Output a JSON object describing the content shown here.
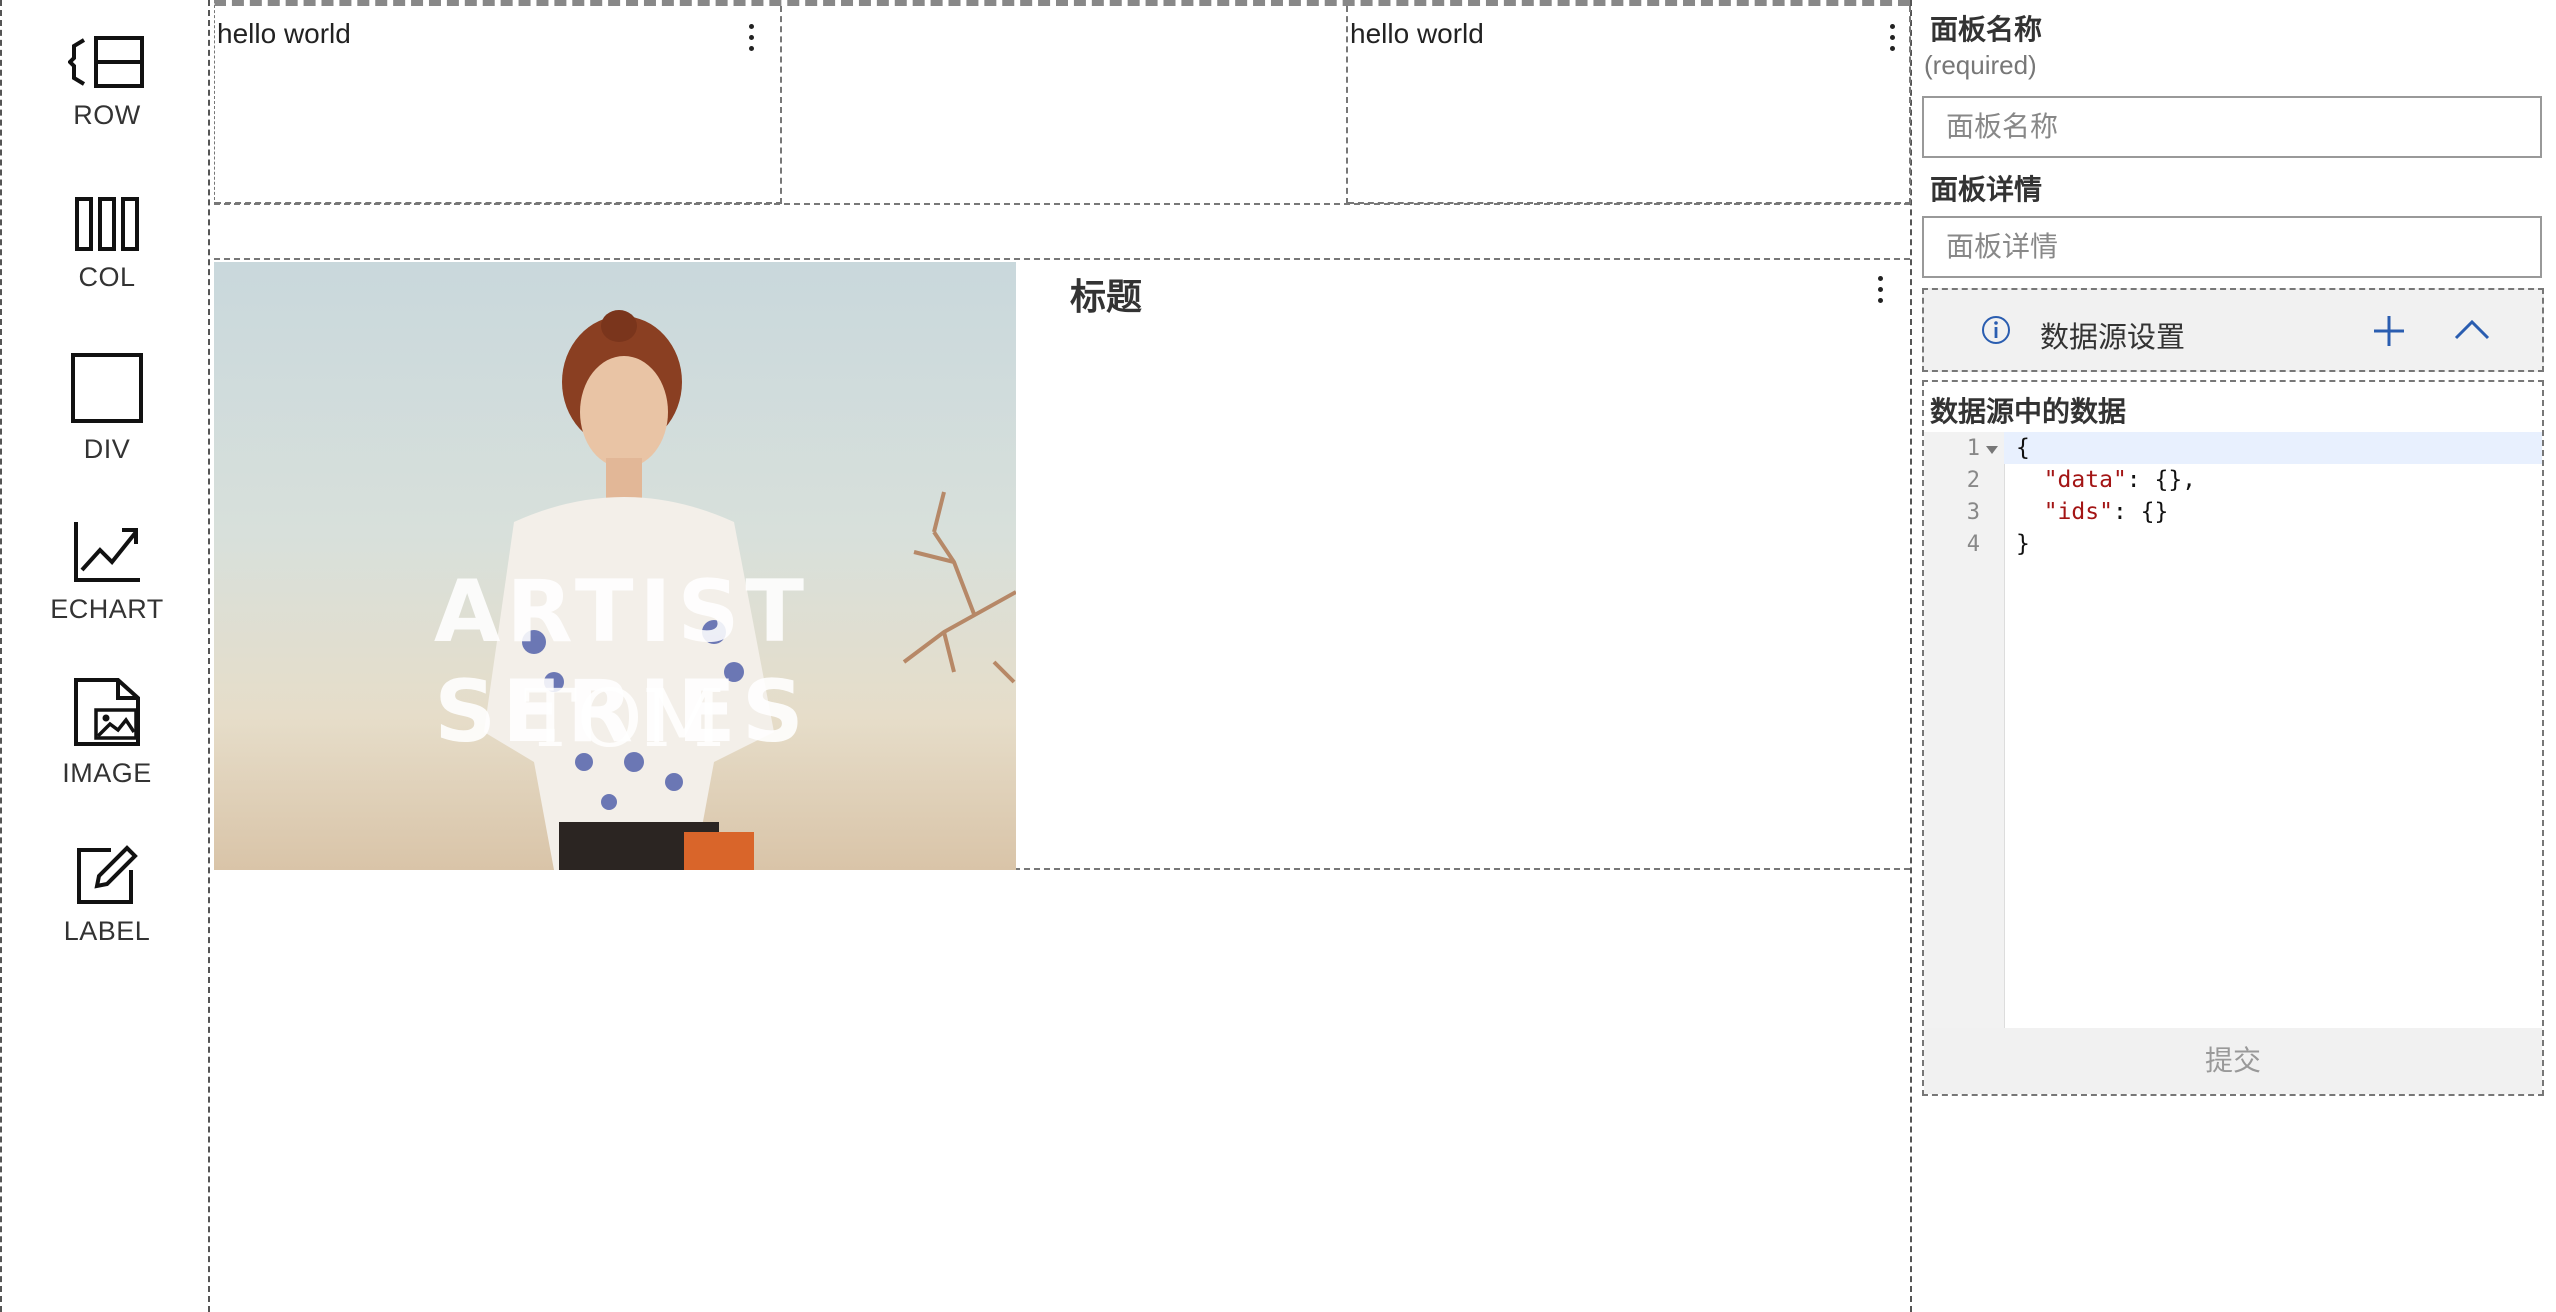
{
  "palette": {
    "items": [
      {
        "label": "ROW",
        "icon": "row-icon"
      },
      {
        "label": "COL",
        "icon": "col-icon"
      },
      {
        "label": "DIV",
        "icon": "div-icon"
      },
      {
        "label": "ECHART",
        "icon": "chart-icon"
      },
      {
        "label": "IMAGE",
        "icon": "image-icon"
      },
      {
        "label": "LABEL",
        "icon": "label-icon"
      }
    ]
  },
  "canvas": {
    "row1": {
      "cell1_text": "hello world",
      "cell3_text": "hello world"
    },
    "card": {
      "image_text_line1": "ARTIST SERIES",
      "image_text_line2": "TOM",
      "title": "标题"
    }
  },
  "props": {
    "name_label": "面板名称",
    "name_hint": "(required)",
    "name_placeholder": "面板名称",
    "detail_label": "面板详情",
    "detail_placeholder": "面板详情",
    "datasource_title": "数据源设置",
    "datasource_box_title": "数据源中的数据",
    "editor": {
      "line_numbers": [
        "1",
        "2",
        "3",
        "4"
      ],
      "line1": "{",
      "line2_key": "\"data\"",
      "line2_rest": ": {},",
      "line3_key": "\"ids\"",
      "line3_rest": ": {}",
      "line4": "}"
    },
    "submit_label": "提交"
  },
  "colors": {
    "accent": "#2a5db0",
    "json_string": "#a31515",
    "highlight_line": "#e8f0fe"
  }
}
